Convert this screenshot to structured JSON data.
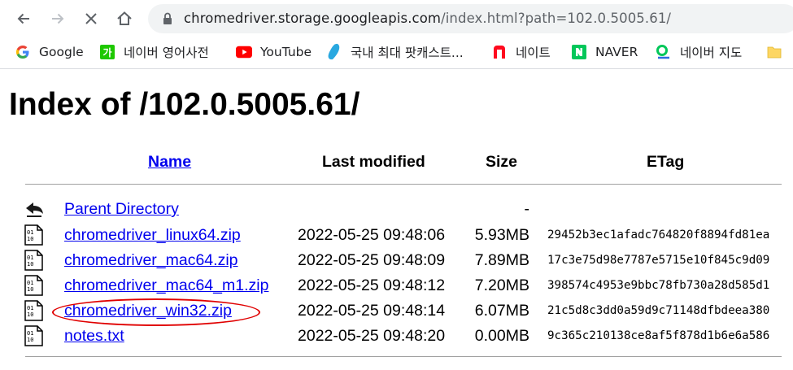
{
  "browser": {
    "url_host": "chromedriver.storage.googleapis.com",
    "url_path": "/index.html?path=102.0.5005.61/"
  },
  "bookmarks": [
    {
      "label": "Google",
      "icon": "google-icon"
    },
    {
      "label": "네이버 영어사전",
      "icon": "naver-dictionary-icon"
    },
    {
      "label": "YouTube",
      "icon": "youtube-icon"
    },
    {
      "label": "국내 최대 팟캐스트...",
      "icon": "podcast-icon"
    },
    {
      "label": "네이트",
      "icon": "nate-icon"
    },
    {
      "label": "NAVER",
      "icon": "naver-icon"
    },
    {
      "label": "네이버 지도",
      "icon": "naver-map-icon"
    },
    {
      "label": "",
      "icon": "folder-icon"
    }
  ],
  "page": {
    "title": "Index of /102.0.5005.61/",
    "columns": {
      "name": "Name",
      "modified": "Last modified",
      "size": "Size",
      "etag": "ETag"
    },
    "rows": [
      {
        "name": "Parent Directory",
        "modified": "",
        "size": "-",
        "etag": "",
        "icon": "back-arrow-icon"
      },
      {
        "name": "chromedriver_linux64.zip",
        "modified": "2022-05-25 09:48:06",
        "size": "5.93MB",
        "etag": "29452b3ec1afadc764820f8894fd81ea",
        "icon": "binary-file-icon"
      },
      {
        "name": "chromedriver_mac64.zip",
        "modified": "2022-05-25 09:48:09",
        "size": "7.89MB",
        "etag": "17c3e75d98e7787e5715e10f845c9d09",
        "icon": "binary-file-icon"
      },
      {
        "name": "chromedriver_mac64_m1.zip",
        "modified": "2022-05-25 09:48:12",
        "size": "7.20MB",
        "etag": "398574c4953e9bbc78fb730a28d585d1",
        "icon": "binary-file-icon"
      },
      {
        "name": "chromedriver_win32.zip",
        "modified": "2022-05-25 09:48:14",
        "size": "6.07MB",
        "etag": "21c5d8c3dd0a59d9c71148dfbdeea380",
        "icon": "binary-file-icon"
      },
      {
        "name": "notes.txt",
        "modified": "2022-05-25 09:48:20",
        "size": "0.00MB",
        "etag": "9c365c210138ce8af5f878d1b6e6a586",
        "icon": "binary-file-icon"
      }
    ]
  },
  "colors": {
    "link": "#0000ee",
    "highlight": "#e00000",
    "omnibox": "#f1f3f4"
  }
}
